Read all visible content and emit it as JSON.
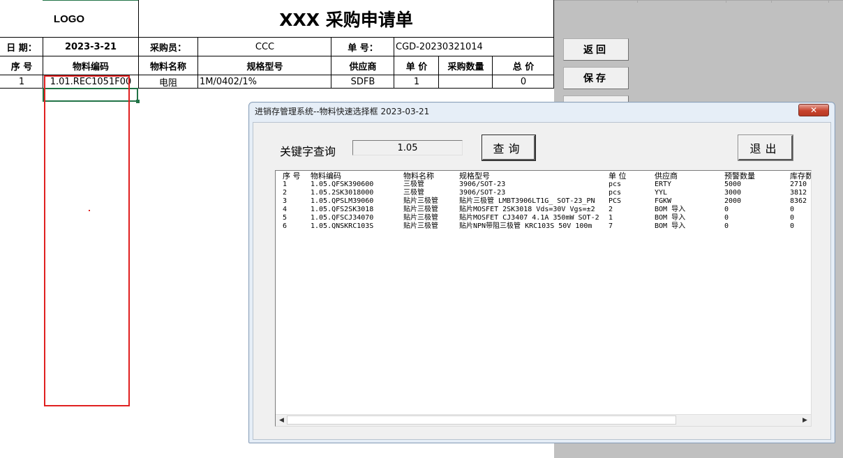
{
  "sheet": {
    "logo": "LOGO",
    "title": "XXX 采购申请单",
    "date_label": "日 期：",
    "date_value": "2023-3-21",
    "buyer_label": "采购员：",
    "buyer_value": "CCC",
    "order_label": "单 号：",
    "order_value": "CGD-20230321014",
    "columns": [
      "序 号",
      "物料编码",
      "物料名称",
      "规格型号",
      "供应商",
      "单 价",
      "采购数量",
      "总 价"
    ],
    "row": {
      "seq": "1",
      "code": "1.01.REC1051F00",
      "name": "电阻",
      "spec": "1M/0402/1%",
      "supplier": "SDFB",
      "price": "1",
      "qty": "",
      "total": "0"
    },
    "buttons": {
      "back": "返回",
      "save": "保存"
    }
  },
  "dialog": {
    "title": "进销存管理系统--物料快速选择框 2023-03-21",
    "close_label": "✕",
    "keyword_label": "关键字查询",
    "keyword_value": "1.05",
    "search_label": "查询",
    "exit_label": "退出",
    "list_headers": [
      "序 号",
      "物料编码",
      "物料名称",
      "规格型号",
      "单 位",
      "供应商",
      "预警数量",
      "库存数"
    ],
    "list_rows": [
      [
        "1",
        "1.05.QFSK390600",
        "三极管",
        "3906/SOT-23",
        "pcs",
        "ERTY",
        "5000",
        "2710"
      ],
      [
        "2",
        "1.05.2SK3018000",
        "三极管",
        "3906/SOT-23",
        "pcs",
        "YYL",
        "3000",
        "3812"
      ],
      [
        "3",
        "1.05.QPSLM39060",
        "贴片三极管",
        "贴片三极管 LMBT3906LT1G_ SOT-23_PN",
        "PCS",
        "FGKW",
        "2000",
        "8362"
      ],
      [
        "4",
        "1.05.QFS2SK3018",
        "贴片三极管",
        "贴片MOSFET 2SK3018 Vds=30V Vgs=±2",
        "2",
        "BOM 导入",
        "0",
        "0"
      ],
      [
        "5",
        "1.05.QFSCJ34070",
        "贴片三极管",
        "贴片MOSFET CJ3407 4.1A 350mW SOT-2",
        "1",
        "BOM 导入",
        "0",
        "0"
      ],
      [
        "6",
        "1.05.QNSKRC103S",
        "贴片三极管",
        "贴片NPN带阻三极管 KRC103S 50V 100m",
        "7",
        "BOM 导入",
        "0",
        "0"
      ]
    ],
    "scroll_left": "◀",
    "scroll_right": "▶"
  },
  "colors": {
    "selection_border": "#217346",
    "red_box": "#e02020",
    "dialog_bg": "#e6eef7",
    "close_red": "#c7432d"
  }
}
